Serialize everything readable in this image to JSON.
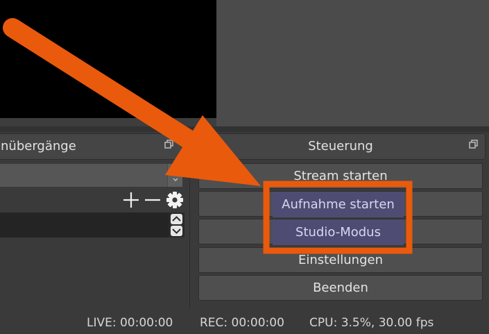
{
  "docks": {
    "transitions": {
      "title": "nübergänge"
    },
    "controls": {
      "title": "Steuerung",
      "buttons": [
        "Stream starten",
        "Aufnahme starten",
        "Studio-Modus",
        "Einstellungen",
        "Beenden"
      ]
    }
  },
  "status": {
    "live": "LIVE: 00:00:00",
    "rec": "REC: 00:00:00",
    "cpu": "CPU: 3.5%, 30.00 fps"
  },
  "annotation": {
    "arrow_color": "#ea5a0c",
    "highlight_color": "#ea5a0c"
  },
  "icons": {
    "add": "plus-icon",
    "remove": "minus-icon",
    "settings": "gear-icon",
    "float": "float-dock-icon",
    "spin_up": "chevron-up-icon",
    "spin_down": "chevron-down-icon"
  }
}
